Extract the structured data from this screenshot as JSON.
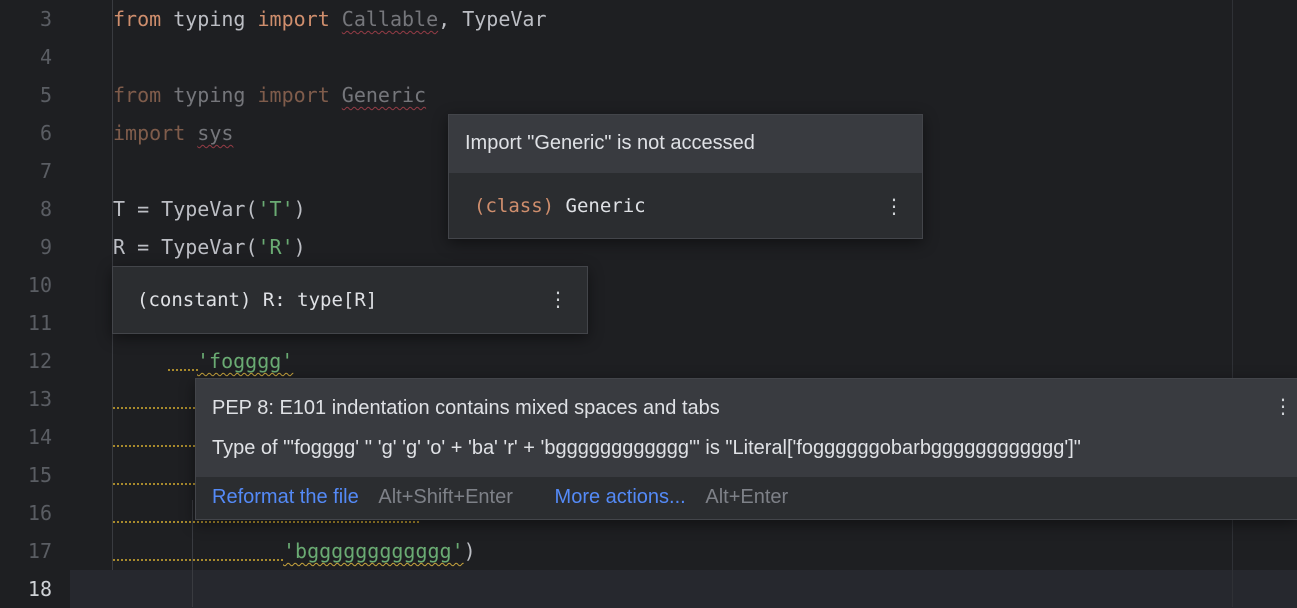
{
  "gutter": {
    "line_numbers": [
      "3",
      "4",
      "5",
      "6",
      "7",
      "8",
      "9",
      "10",
      "11",
      "12",
      "13",
      "14",
      "15",
      "16",
      "17",
      "18"
    ],
    "current_line": "18"
  },
  "code": {
    "l3": {
      "from": "from",
      "mod": " typing ",
      "imp": "import",
      "callable": "Callable",
      "rest": ", TypeVar"
    },
    "l5": {
      "from": "from",
      "mod": " typing ",
      "imp": "import",
      "generic": "Generic"
    },
    "l6": {
      "imp": "import",
      "sys": "sys"
    },
    "l8": {
      "a": "T = TypeVar(",
      "s": "'T'",
      "b": ")"
    },
    "l9": {
      "a": "R = TypeVar(",
      "s": "'R'",
      "b": ")"
    },
    "l12": {
      "s": "'fogggg'"
    },
    "l17": {
      "s": "'bgggggggggggg'",
      "b": ")"
    }
  },
  "popup_generic": {
    "title": "Import \"Generic\" is not accessed",
    "kind": "(class)",
    "name": " Generic"
  },
  "popup_constant": {
    "text": "(constant) R: type[R]"
  },
  "popup_pep8": {
    "title": "PEP 8: E101 indentation contains mixed spaces and tabs",
    "detail": "Type of \"'fogggg' '' 'g' 'g' 'o' + 'ba' 'r' + 'bgggggggggggg'\" is \"Literal['foggggggobarbgggggggggggg']\"",
    "action_label": "Reformat the file",
    "action_shortcut": "Alt+Shift+Enter",
    "more_label": "More actions...",
    "more_shortcut": "Alt+Enter"
  },
  "icons": {
    "more": "more-vertical-icon"
  },
  "colors": {
    "background": "#1e1f22",
    "popup": "#2b2d30",
    "keyword": "#cf8e6d",
    "string": "#6aab73",
    "link": "#548af7"
  }
}
